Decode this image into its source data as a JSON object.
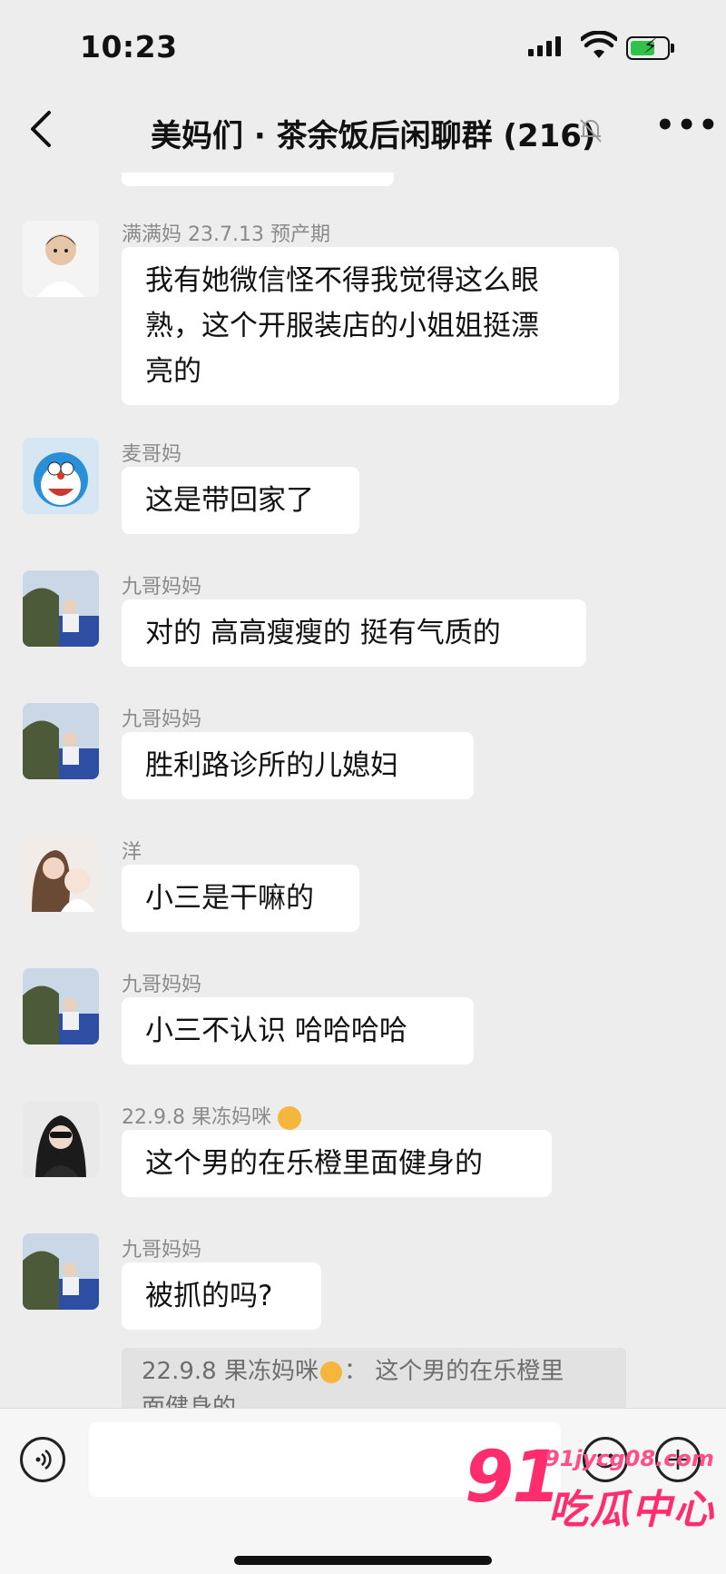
{
  "status": {
    "time": "10:23"
  },
  "header": {
    "back_icon": "chevron-left-icon",
    "title": "美妈们 · 茶余饭后闲聊群 (216)",
    "mute_icon": "bell-muted-icon",
    "more_icon": "more-icon"
  },
  "messages": [
    {
      "sender": "满满妈 23.7.13 预产期",
      "lines": [
        "我有她微信怪不得我觉得这么眼",
        "熟，这个开服装店的小姐姐挺漂",
        "亮的"
      ]
    },
    {
      "sender": "麦哥妈",
      "lines": [
        "这是带回家了"
      ]
    },
    {
      "sender": "九哥妈妈",
      "lines": [
        " 对的 高高瘦瘦的 挺有气质的"
      ]
    },
    {
      "sender": "九哥妈妈",
      "lines": [
        " 胜利路诊所的儿媳妇"
      ]
    },
    {
      "sender": "洋",
      "lines": [
        "小三是干嘛的"
      ]
    },
    {
      "sender": "九哥妈妈",
      "lines": [
        " 小三不认识 哈哈哈哈"
      ]
    },
    {
      "sender": "22.9.8 果冻妈咪",
      "lines": [
        "这个男的在乐橙里面健身的"
      ]
    },
    {
      "sender": "九哥妈妈",
      "lines": [
        "被抓的吗?"
      ]
    }
  ],
  "quote": {
    "line1": "22.9.8 果冻妈咪",
    "line1b": "： 这个男的在乐橙里",
    "line2": "面健身的"
  },
  "input": {
    "voice_icon": "voice-icon",
    "emoji_icon": "emoji-icon",
    "plus_icon": "plus-icon"
  },
  "watermark": {
    "brand": "91",
    "site": "91jycg08.com",
    "name": "吃瓜中心"
  }
}
